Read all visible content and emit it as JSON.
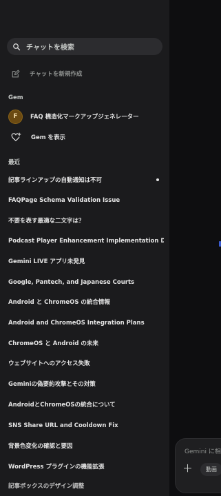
{
  "sidebar": {
    "search_placeholder": "チャットを検索",
    "new_chat_label": "チャットを新規作成",
    "gem_section_label": "Gem",
    "gem": {
      "avatar_letter": "F",
      "label": "FAQ 構造化マークアップジェネレーター"
    },
    "show_gems_label": "Gem を表示",
    "recent_section_label": "最近",
    "chats": [
      "記事ラインアップの自動通知は不可",
      "FAQPage Schema Validation Issue",
      "不要を表す最適な二文字は？",
      "Podcast Player Enhancement Implementation Details",
      "Gemini LIVE アプリ未発見",
      "Google, Pantech, and Japanese Courts",
      "Android と ChromeOS の統合情報",
      "Android and ChromeOS Integration Plans",
      "ChromeOS と Android の未来",
      "ウェブサイトへのアクセス失敗",
      "Geminiの偽要約攻撃とその対策",
      "AndroidとChromeOSの統合について",
      "SNS Share URL and Cooldown Fix",
      "背景色変化の確認と要因",
      "WordPress プラグインの機能拡張",
      "記事ボックスのデザイン調整"
    ]
  },
  "main": {
    "input_placeholder": "Gemini に相",
    "tools_chip_label": "動画"
  },
  "colors": {
    "sidebar_bg": "#1b1b1d",
    "main_bg": "#0e0e10",
    "search_bg": "#2c2c2f",
    "avatar_bg": "#6b4a12"
  }
}
